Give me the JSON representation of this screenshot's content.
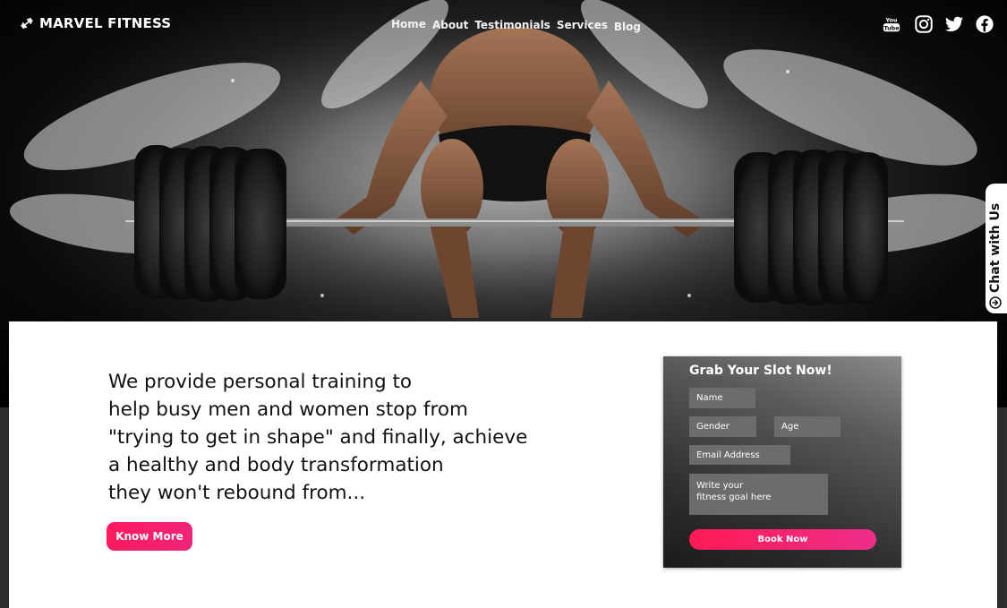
{
  "brand": {
    "name": "MARVEL FITNESS",
    "icon": "dumbbell-icon"
  },
  "nav": {
    "items": [
      "Home",
      "About",
      "Testimonials",
      "Services",
      "Blog"
    ]
  },
  "social": [
    "youtube-icon",
    "instagram-icon",
    "twitter-icon",
    "facebook-icon"
  ],
  "chat": {
    "label": "Chat with Us",
    "icon": "arrow-circle-icon"
  },
  "hero": {
    "image": "weightlifter-deadlift-barbell-powder-burst"
  },
  "pitch": {
    "lines": [
      "We provide personal training to",
      "help busy men and women stop from",
      "\"trying to get in shape\" and finally, achieve",
      "a healthy and body transformation",
      "they won't rebound from..."
    ],
    "cta": "Know More"
  },
  "form": {
    "title": "Grab Your Slot Now!",
    "name_placeholder": "Name",
    "gender_placeholder": "Gender",
    "age_placeholder": "Age",
    "email_placeholder": "Email Address",
    "goal_placeholder": "Write your\nfitness goal here",
    "submit": "Book Now"
  },
  "colors": {
    "accent": "#ff1a5e",
    "accent_end": "#ee2e8a",
    "form_field": "#6c6c6c",
    "hero_bg": "#000000"
  }
}
